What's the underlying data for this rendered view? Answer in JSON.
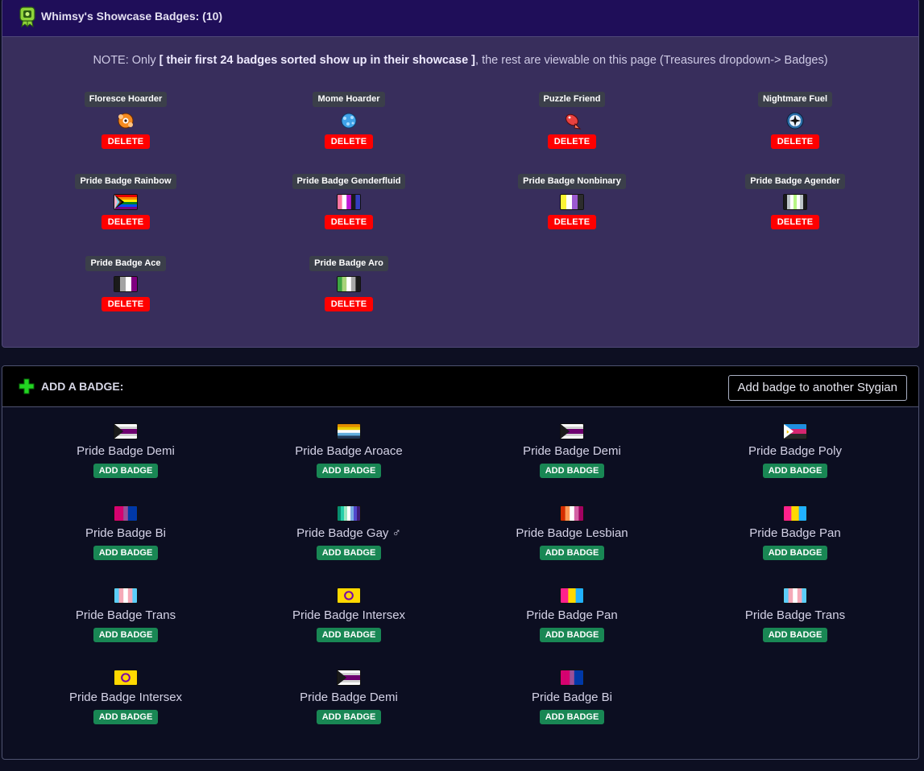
{
  "showcase": {
    "title": "Whimsy's Showcase Badges: (10)",
    "note_prefix": "NOTE: Only ",
    "note_bold": "[ their first 24 badges sorted show up in their showcase ]",
    "note_suffix": ", the rest are viewable on this page (Treasures dropdown-> Badges)",
    "delete_label": "DELETE",
    "badges": [
      {
        "name": "Floresce Hoarder",
        "icon": "floresce-icon"
      },
      {
        "name": "Mome Hoarder",
        "icon": "mome-icon"
      },
      {
        "name": "Puzzle Friend",
        "icon": "puzzle-fish-icon"
      },
      {
        "name": "Nightmare Fuel",
        "icon": "nightmare-compass-icon"
      },
      {
        "name": "Pride Badge Rainbow",
        "icon": "rainbow-flag-icon"
      },
      {
        "name": "Pride Badge Genderfluid",
        "icon": "genderfluid-flag-icon"
      },
      {
        "name": "Pride Badge Nonbinary",
        "icon": "nonbinary-flag-icon"
      },
      {
        "name": "Pride Badge Agender",
        "icon": "agender-flag-icon"
      },
      {
        "name": "Pride Badge Ace",
        "icon": "ace-flag-icon"
      },
      {
        "name": "Pride Badge Aro",
        "icon": "aro-flag-icon"
      }
    ]
  },
  "add_section": {
    "title": "ADD A BADGE:",
    "other_button": "Add badge to another Stygian",
    "add_label": "ADD BADGE",
    "badges": [
      {
        "name": "Pride Badge Demi",
        "icon": "demi-flag-icon"
      },
      {
        "name": "Pride Badge Aroace",
        "icon": "aroace-flag-icon"
      },
      {
        "name": "Pride Badge Demi",
        "icon": "demi-flag-icon"
      },
      {
        "name": "Pride Badge Poly",
        "icon": "poly-flag-icon"
      },
      {
        "name": "Pride Badge Bi",
        "icon": "bi-flag-icon"
      },
      {
        "name": "Pride Badge Gay ♂",
        "icon": "gay-flag-icon"
      },
      {
        "name": "Pride Badge Lesbian",
        "icon": "lesbian-flag-icon"
      },
      {
        "name": "Pride Badge Pan",
        "icon": "pan-flag-icon"
      },
      {
        "name": "Pride Badge Trans",
        "icon": "trans-flag-icon"
      },
      {
        "name": "Pride Badge Intersex",
        "icon": "intersex-flag-icon"
      },
      {
        "name": "Pride Badge Pan",
        "icon": "pan-flag-icon"
      },
      {
        "name": "Pride Badge Trans",
        "icon": "trans-flag-icon"
      },
      {
        "name": "Pride Badge Intersex",
        "icon": "intersex-flag-icon"
      },
      {
        "name": "Pride Badge Demi",
        "icon": "demi-flag-icon"
      },
      {
        "name": "Pride Badge Bi",
        "icon": "bi-flag-icon"
      }
    ]
  },
  "colors": {
    "panel_bg": "#382e5c",
    "header_bg": "#1f0e59",
    "delete_red": "#ff0000",
    "add_green": "#198754"
  }
}
